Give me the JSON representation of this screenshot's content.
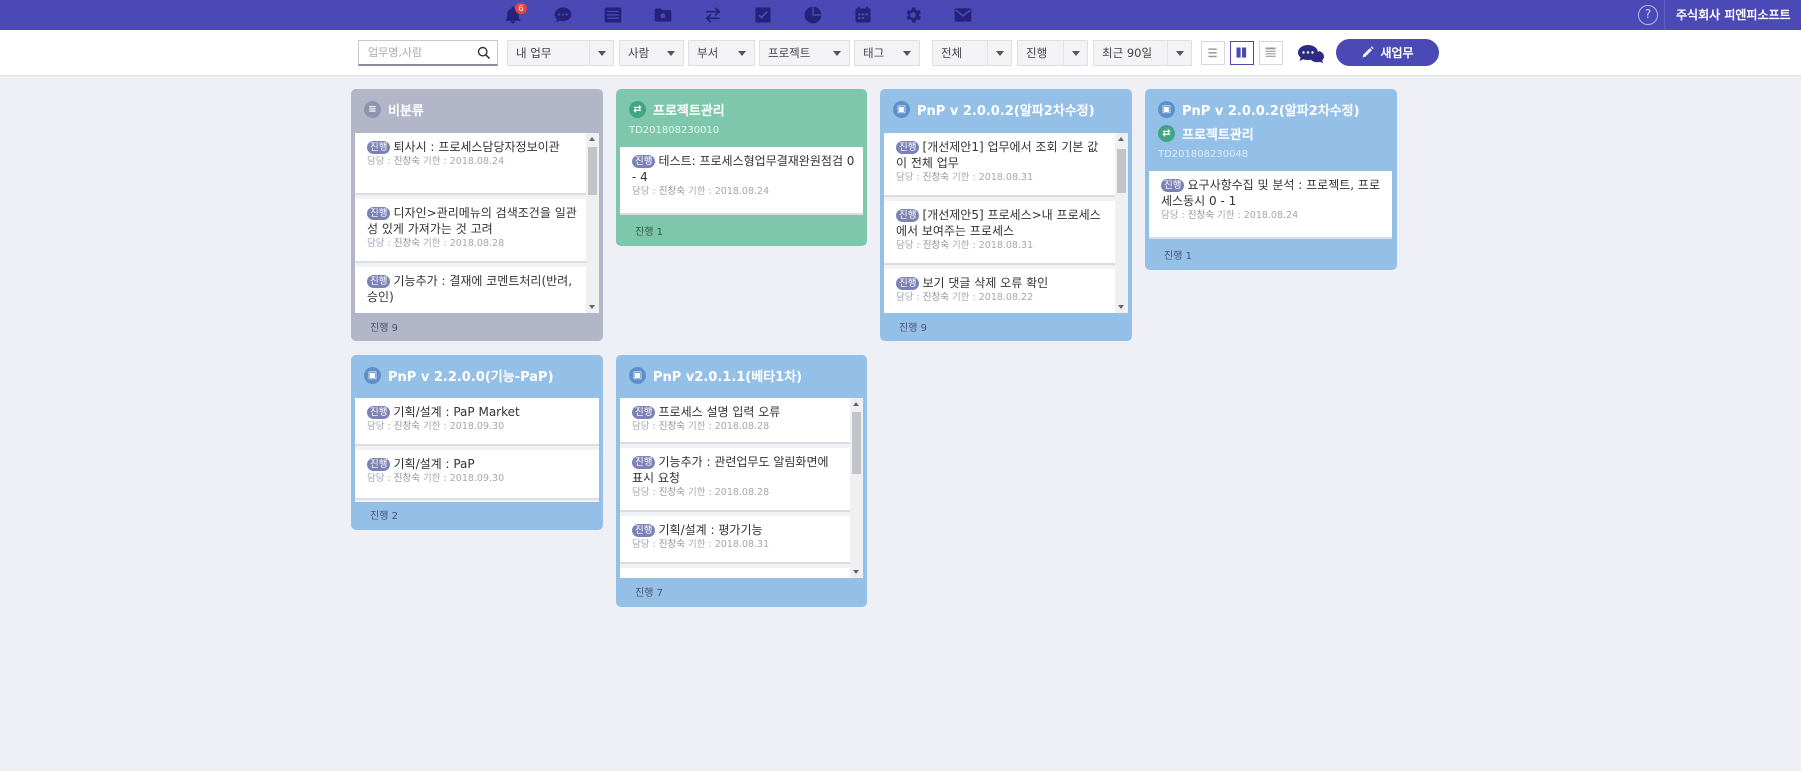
{
  "topbar": {
    "icons": [
      {
        "name": "bell-icon",
        "badge": "6"
      },
      {
        "name": "chat-icon"
      },
      {
        "name": "list-icon"
      },
      {
        "name": "folder-icon"
      },
      {
        "name": "transfer-icon"
      },
      {
        "name": "checkbox-icon"
      },
      {
        "name": "pie-chart-icon"
      },
      {
        "name": "calendar-icon"
      },
      {
        "name": "gear-icon"
      },
      {
        "name": "mail-icon"
      }
    ],
    "help_label": "?",
    "company": "주식회사 피엔피소프트"
  },
  "toolbar": {
    "search_placeholder": "업무명,사람",
    "filters": {
      "my_task": "내 업무",
      "person": "사람",
      "dept": "부서",
      "project": "프로젝트",
      "tag": "태그",
      "all": "전체",
      "status": "진행",
      "period": "최근 90일"
    },
    "new_task_label": "새업무"
  },
  "colors": {
    "brand": "#4a49b5",
    "gray_board": "#b3b5c9",
    "green_board": "#7ec7ad",
    "blue_board": "#94c0e8"
  },
  "boards": [
    {
      "title": "비분류",
      "footer": "진행 9",
      "cards": [
        {
          "tag": "진행",
          "title": "퇴사시 : 프로세스담당자정보이관",
          "meta_label": "담당 : ",
          "owner": "진창숙",
          "due_label": "기한 : ",
          "due": "2018.08.24"
        },
        {
          "tag": "진행",
          "title": "디자인>관리메뉴의 검색조건을 일관성 있게 가져가는 것 고려",
          "meta_label": "담당 : ",
          "owner": "진창숙",
          "due_label": "기한 : ",
          "due": "2018.08.28"
        },
        {
          "tag": "진행",
          "title": "기능추가 : 결재에 코멘트처리(반려, 승인)",
          "meta_label": "",
          "owner": "",
          "due_label": "",
          "due": ""
        }
      ]
    },
    {
      "title": "프로젝트관리",
      "subtitle": "TD201808230010",
      "footer": "진행 1",
      "cards": [
        {
          "tag": "진행",
          "title": "테스트: 프로세스형업무결재완원점검 0 - 4",
          "meta_label": "담당 : ",
          "owner": "진창숙",
          "due_label": "기한 : ",
          "due": "2018.08.24"
        }
      ]
    },
    {
      "title": "PnP v 2.0.0.2(알파2차수정)",
      "footer": "진행 9",
      "cards": [
        {
          "tag": "진행",
          "title": "[개선제안1] 업무에서 조회 기본 값이 전체 업무",
          "meta_label": "담당 : ",
          "owner": "진창숙",
          "due_label": "기한 : ",
          "due": "2018.08.31"
        },
        {
          "tag": "진행",
          "title": "[개선제안5] 프로세스>내 프로세스에서 보여주는 프로세스",
          "meta_label": "담당 : ",
          "owner": "진창숙",
          "due_label": "기한 : ",
          "due": "2018.08.31"
        },
        {
          "tag": "진행",
          "title": "보기 댓글 삭제 오류 확인",
          "meta_label": "담당 : ",
          "owner": "진창숙",
          "due_label": "기한 : ",
          "due": "2018.08.22"
        }
      ]
    },
    {
      "title": "PnP v 2.0.0.2(알파2차수정)",
      "title2": "프로젝트관리",
      "subtitle": "TD201808230048",
      "footer": "진행 1",
      "cards": [
        {
          "tag": "진행",
          "title": "요구사항수집 및 분석 : 프로젝트, 프로세스동시 0 - 1",
          "meta_label": "담당 : ",
          "owner": "진창숙",
          "due_label": "기한 : ",
          "due": "2018.08.24"
        }
      ]
    },
    {
      "title": "PnP v 2.2.0.0(기능-PaP)",
      "footer": "진행 2",
      "cards": [
        {
          "tag": "진행",
          "title": "기획/설계 : PaP Market",
          "meta_label": "담당 : ",
          "owner": "진창숙",
          "due_label": "기한 : ",
          "due": "2018.09.30"
        },
        {
          "tag": "진행",
          "title": "기획/설계 : PaP",
          "meta_label": "담당 : ",
          "owner": "진창숙",
          "due_label": "기한 : ",
          "due": "2018.09.30"
        }
      ]
    },
    {
      "title": "PnP v2.0.1.1(베타1차)",
      "footer": "진행 7",
      "cards": [
        {
          "tag": "진행",
          "title": "프로세스 설명 입력 오류",
          "meta_label": "담당 : ",
          "owner": "진창숙",
          "due_label": "기한 : ",
          "due": "2018.08.28"
        },
        {
          "tag": "진행",
          "title": "기능추가 : 관련업무도 알림화면에 표시 요청",
          "meta_label": "담당 : ",
          "owner": "진창숙",
          "due_label": "기한 : ",
          "due": "2018.08.28"
        },
        {
          "tag": "진행",
          "title": "기획/설계 : 평가기능",
          "meta_label": "담당 : ",
          "owner": "진창숙",
          "due_label": "기한 : ",
          "due": "2018.08.31"
        }
      ]
    }
  ]
}
